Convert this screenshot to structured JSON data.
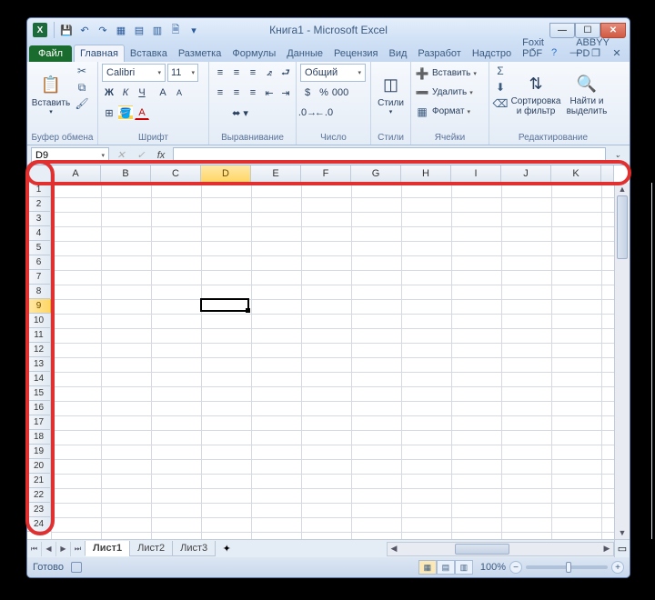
{
  "title": "Книга1 - Microsoft Excel",
  "qat": {
    "excel": "X"
  },
  "tabs": {
    "file": "Файл",
    "items": [
      "Главная",
      "Вставка",
      "Разметка",
      "Формулы",
      "Данные",
      "Рецензия",
      "Вид",
      "Разработ",
      "Надстро",
      "Foxit PDF",
      "ABBYY PD"
    ],
    "active": 0
  },
  "ribbon": {
    "clipboard": {
      "paste": "Вставить",
      "label": "Буфер обмена"
    },
    "font": {
      "name": "Calibri",
      "size": "11",
      "bold": "Ж",
      "italic": "К",
      "underline": "Ч",
      "label": "Шрифт"
    },
    "align": {
      "label": "Выравнивание"
    },
    "number": {
      "format": "Общий",
      "label": "Число"
    },
    "styles": {
      "btn": "Стили",
      "label": "Стили"
    },
    "cells": {
      "insert": "Вставить",
      "delete": "Удалить",
      "format": "Формат",
      "label": "Ячейки"
    },
    "editing": {
      "sort": "Сортировка и фильтр",
      "find": "Найти и выделить",
      "label": "Редактирование"
    }
  },
  "namebox": "D9",
  "fx": "fx",
  "columns": [
    "A",
    "B",
    "C",
    "D",
    "E",
    "F",
    "G",
    "H",
    "I",
    "J",
    "K"
  ],
  "rows": [
    "1",
    "2",
    "3",
    "4",
    "5",
    "6",
    "7",
    "8",
    "9",
    "10",
    "11",
    "12",
    "13",
    "14",
    "15",
    "16",
    "17",
    "18",
    "19",
    "20",
    "21",
    "22",
    "23",
    "24"
  ],
  "selected": {
    "col": "D",
    "row": "9",
    "colIndex": 3,
    "rowIndex": 8
  },
  "sheets": {
    "items": [
      "Лист1",
      "Лист2",
      "Лист3"
    ],
    "active": 0
  },
  "status": {
    "ready": "Готово",
    "zoom": "100%"
  }
}
